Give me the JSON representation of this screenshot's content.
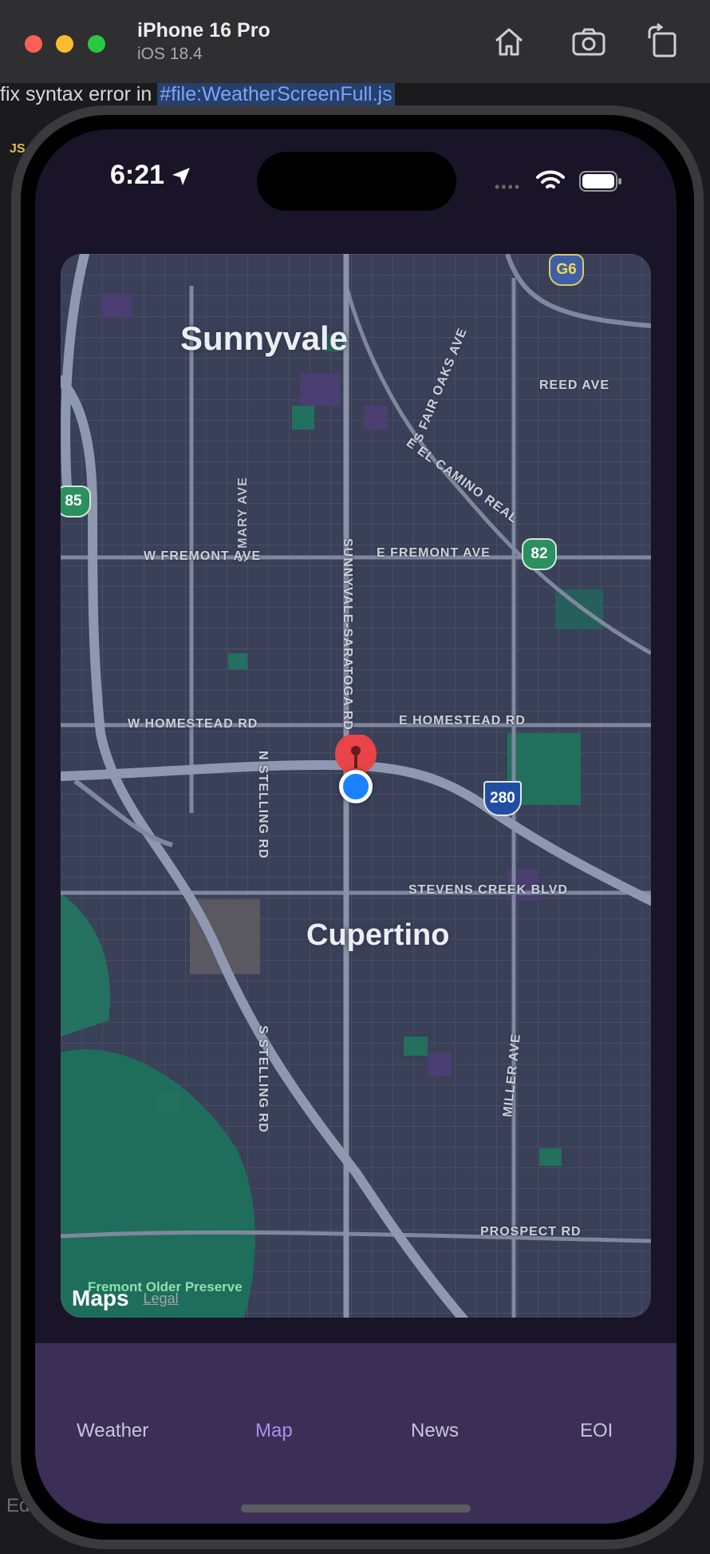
{
  "simulator": {
    "device_name": "iPhone 16 Pro",
    "os_version": "iOS 18.4",
    "toolbar_icons": [
      "home-icon",
      "screenshot-icon",
      "rotate-icon"
    ]
  },
  "editor": {
    "prompt_text": "fix syntax error in ",
    "file_ref": "#file:WeatherScreenFull.js",
    "file_badge": "JS",
    "edit_label": "Edi"
  },
  "status_bar": {
    "time": "6:21"
  },
  "map": {
    "cities": [
      "Sunnyvale",
      "Cupertino"
    ],
    "streets": {
      "s_mary_ave": "S MARY AVE",
      "sunnyvale_saratoga_rd": "SUNNYVALE-SARATOGA RD",
      "s_fair_oaks_ave": "S FAIR OAKS AVE",
      "reed_ave": "REED AVE",
      "e_el_camino_real": "E EL CAMINO REAL",
      "w_fremont_ave": "W FREMONT AVE",
      "e_fremont_ave": "E FREMONT AVE",
      "w_homestead_rd": "W HOMESTEAD RD",
      "e_homestead_rd": "E HOMESTEAD RD",
      "n_stelling_rd": "N STELLING RD",
      "stevens_creek_blvd": "STEVENS CREEK BLVD",
      "s_stelling_rd": "S STELLING RD",
      "miller_ave": "MILLER AVE",
      "prospect_rd": "PROSPECT RD"
    },
    "shields": {
      "g6": "G6",
      "ca85": "85",
      "ca82": "82",
      "i280": "280"
    },
    "attribution": {
      "maps_logo": "Maps",
      "legal": "Legal",
      "park_label": "Fremont Older Preserve"
    },
    "colors": {
      "land": "#394058",
      "road": "#7f889e",
      "park": "#1f6e5c",
      "pin": "#e94448",
      "user_dot": "#1a82ff"
    }
  },
  "tabs": [
    {
      "label": "Weather",
      "active": false
    },
    {
      "label": "Map",
      "active": true
    },
    {
      "label": "News",
      "active": false
    },
    {
      "label": "EOI",
      "active": false
    }
  ],
  "colors": {
    "tab_active": "#a88ff0",
    "tab_inactive": "#c9c4d8",
    "tabbar_bg": "#3b2f57",
    "screen_bg": "#1a1429"
  }
}
